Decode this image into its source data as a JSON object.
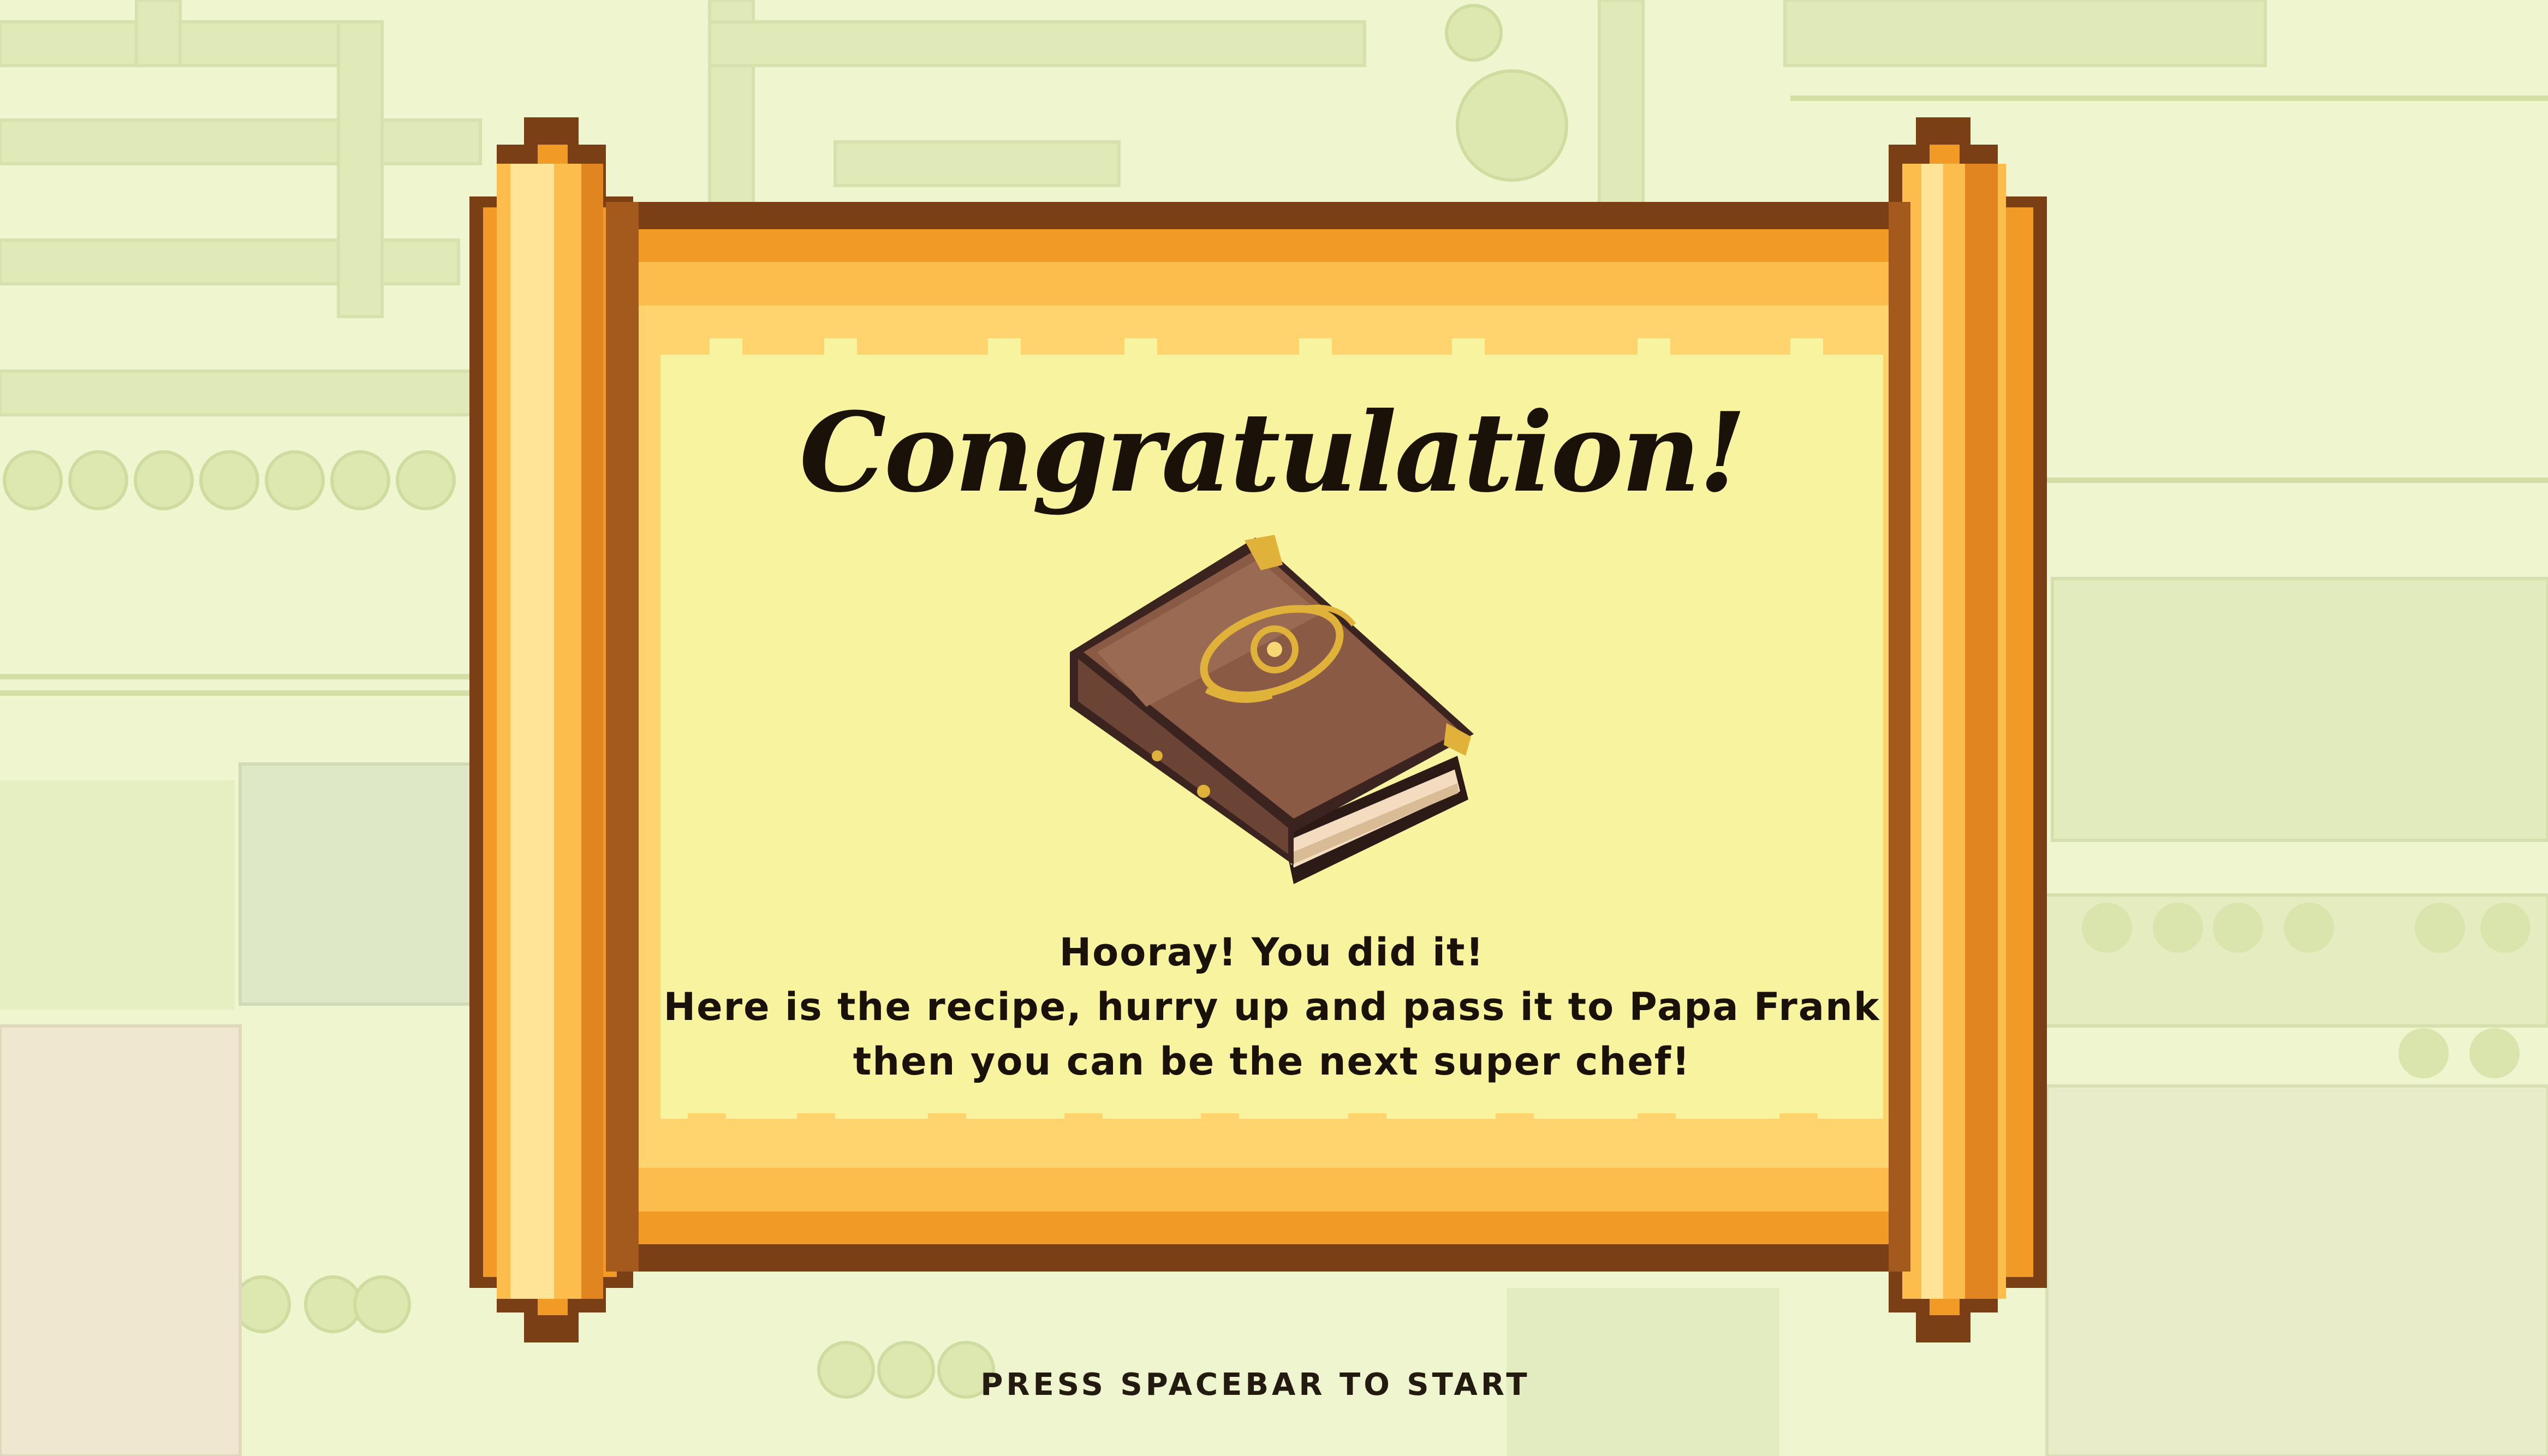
{
  "scene": {
    "title": "Congratulation!",
    "message_lines": [
      "Hooray! You did it!",
      "Here is the recipe, hurry up and pass it to Papa Frank",
      "then you can be the next super chef!"
    ],
    "prompt": "PRESS SPACEBAR TO START"
  },
  "icons": {
    "reward": "recipe-book-icon"
  },
  "colors": {
    "background": "#eef5cf",
    "map_fade": "#e1ecbb",
    "scroll_outline": "#7a3f14",
    "scroll_orange": "#f29a26",
    "scroll_gold": "#fdbd4c",
    "scroll_light": "#ffd36e",
    "paper": "#f7f39e",
    "book_cover": "#8a5a44",
    "book_gold": "#e0b23a",
    "text": "#1a1209"
  }
}
